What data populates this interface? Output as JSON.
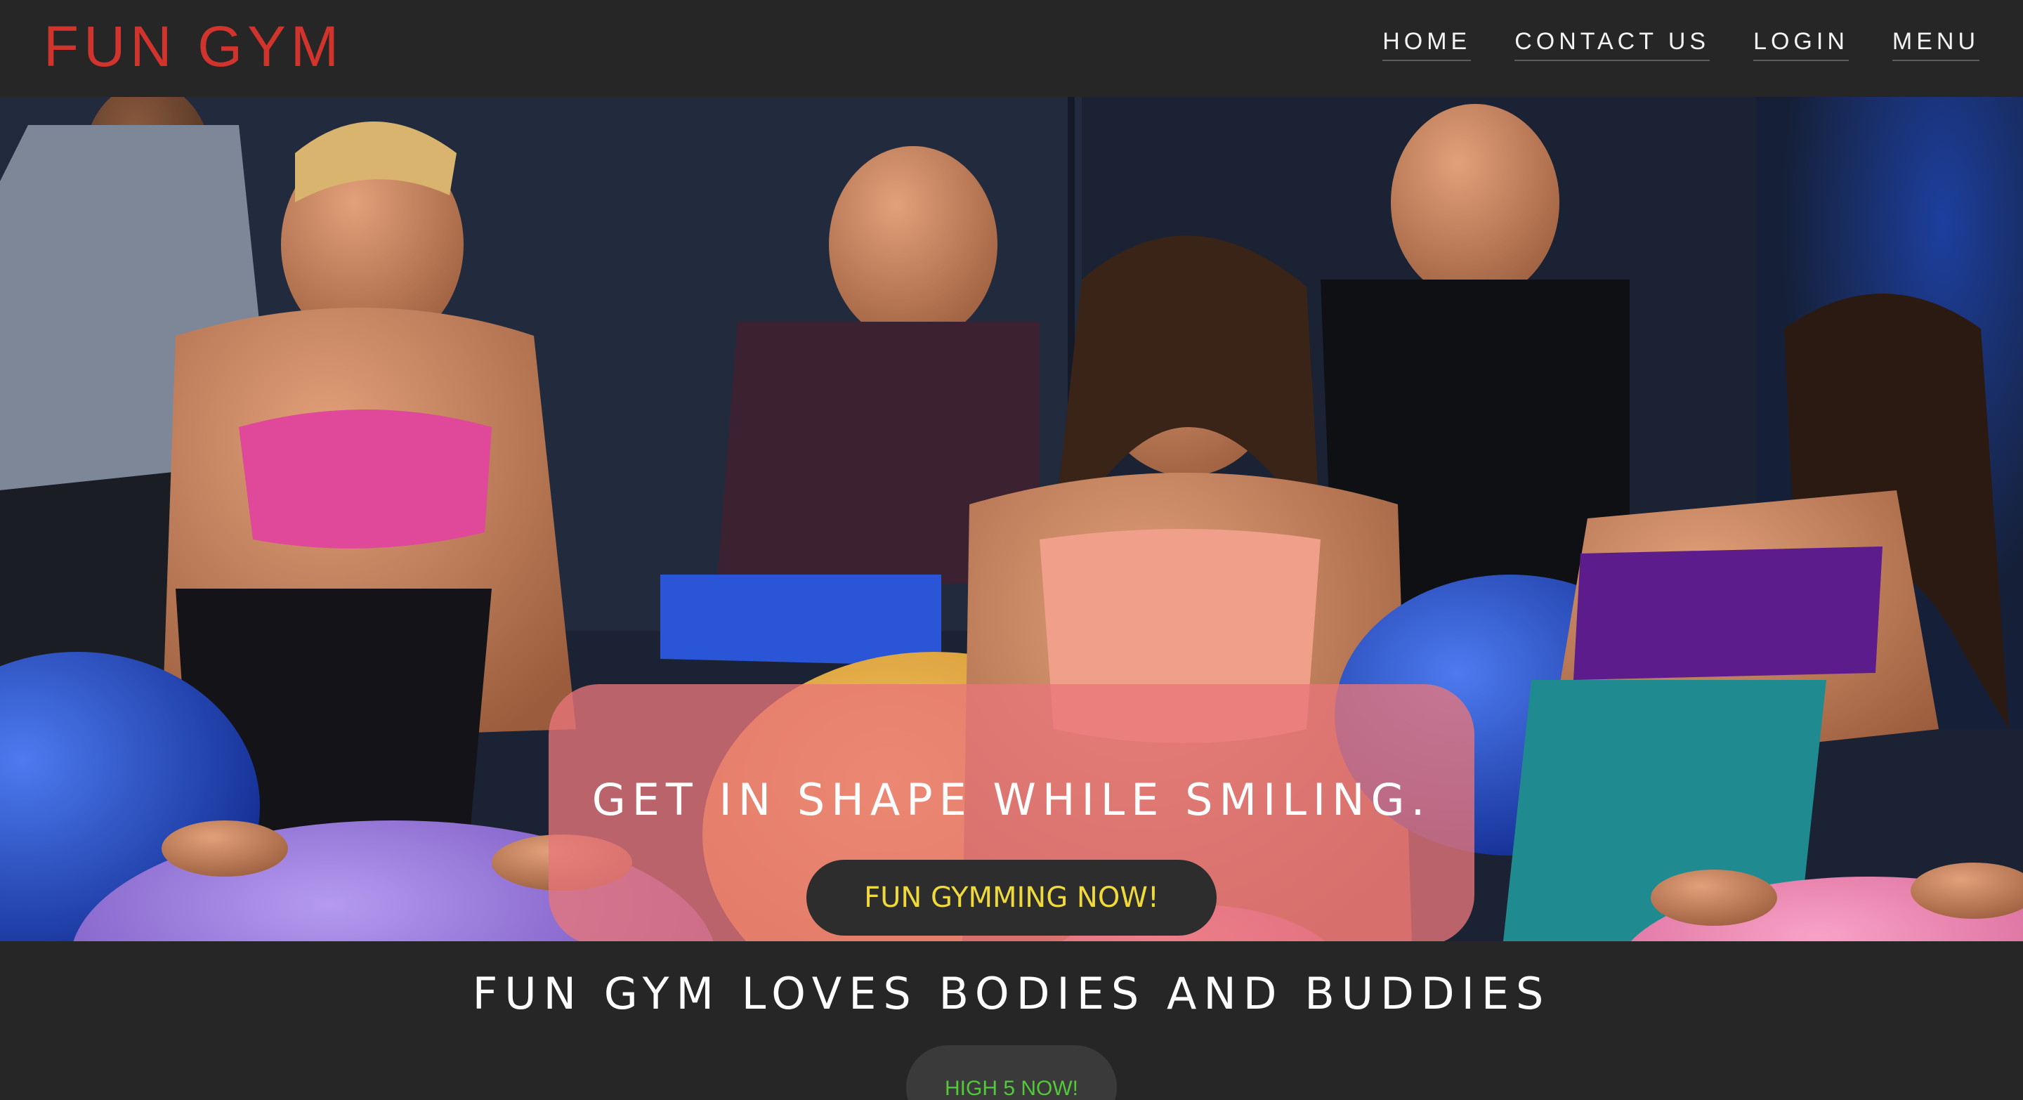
{
  "header": {
    "brand": "FUN GYM",
    "nav": {
      "home": "HOME",
      "contact": "CONTACT US",
      "login": "LOGIN",
      "menu": "MENU"
    }
  },
  "hero": {
    "headline": "GET IN SHAPE WHILE SMILING.",
    "cta_label": "FUN GYMMING NOW!"
  },
  "section": {
    "tagline": "FUN GYM LOVES BODIES AND BUDDIES",
    "button_label": "HIGH 5 NOW!"
  },
  "colors": {
    "brand": "#d0342c",
    "background": "#262626",
    "banner": "#e8767a",
    "cta_text": "#f0d93b",
    "high5_text": "#54c83b"
  }
}
